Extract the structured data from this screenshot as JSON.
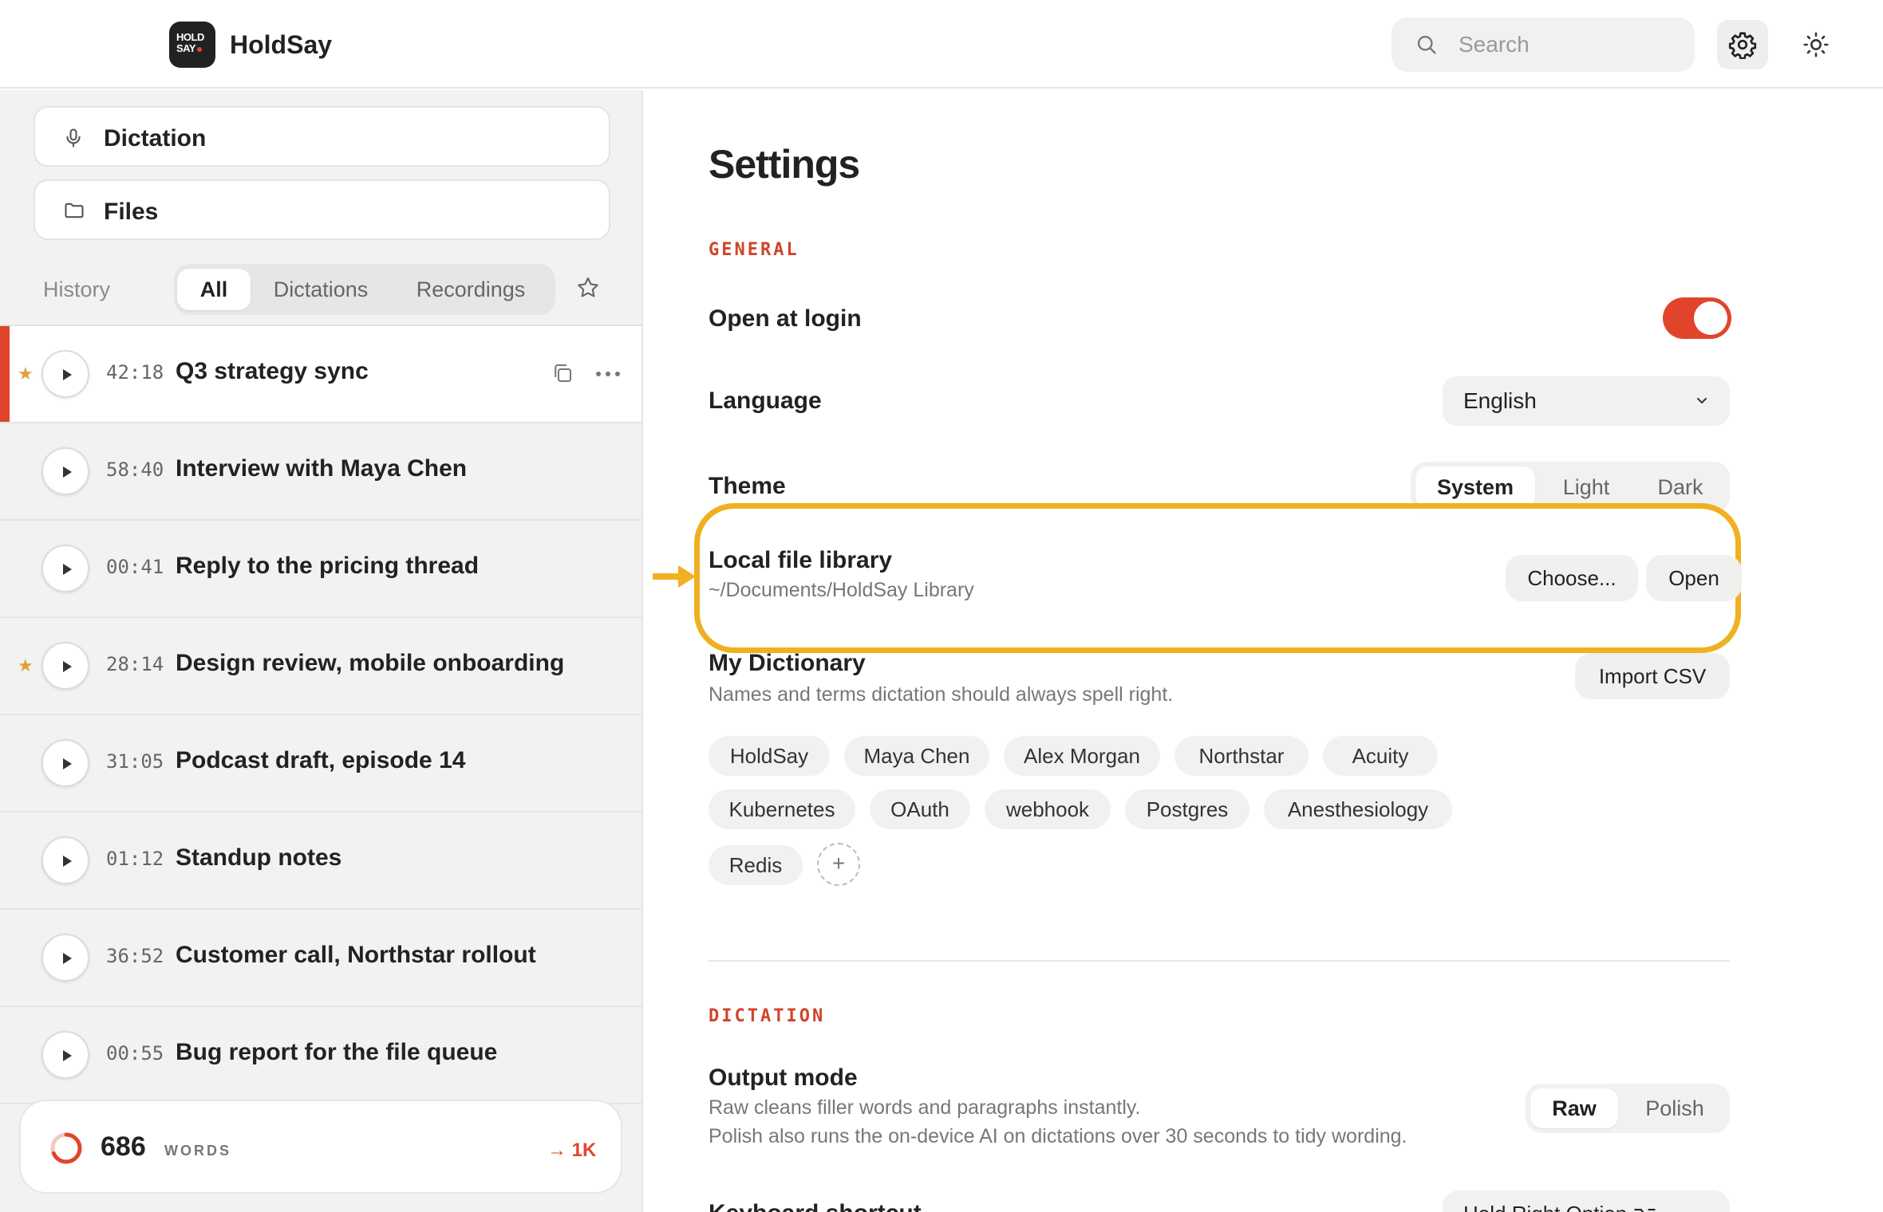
{
  "app": {
    "name": "HoldSay",
    "logo_text_1": "HOLD",
    "logo_text_2": "SAY"
  },
  "header": {
    "search_placeholder": "Search",
    "icons": [
      "search-icon",
      "gear-icon",
      "sun-icon"
    ]
  },
  "sidebar": {
    "nav": [
      {
        "label": "Dictation",
        "icon": "microphone-icon"
      },
      {
        "label": "Files",
        "icon": "folder-icon"
      }
    ],
    "history_label": "History",
    "filters": [
      "All",
      "Dictations",
      "Recordings"
    ],
    "active_filter": "All",
    "rows": [
      {
        "starred": true,
        "duration": "42:18",
        "title": "Q3 strategy sync",
        "selected": true
      },
      {
        "starred": false,
        "duration": "58:40",
        "title": "Interview with Maya Chen",
        "selected": false
      },
      {
        "starred": false,
        "duration": "00:41",
        "title": "Reply to the pricing thread",
        "selected": false
      },
      {
        "starred": true,
        "duration": "28:14",
        "title": "Design review, mobile onboarding",
        "selected": false
      },
      {
        "starred": false,
        "duration": "31:05",
        "title": "Podcast draft, episode 14",
        "selected": false
      },
      {
        "starred": false,
        "duration": "01:12",
        "title": "Standup notes",
        "selected": false
      },
      {
        "starred": false,
        "duration": "36:52",
        "title": "Customer call, Northstar rollout",
        "selected": false
      },
      {
        "starred": false,
        "duration": "00:55",
        "title": "Bug report for the file queue",
        "selected": false
      }
    ],
    "words": {
      "count": "686",
      "unit": "WORDS",
      "goal": "→ 1K",
      "progress": 0.686
    }
  },
  "settings": {
    "title": "Settings",
    "general_label": "GENERAL",
    "open_at_login": {
      "label": "Open at login",
      "enabled": true
    },
    "language": {
      "label": "Language",
      "value": "English"
    },
    "theme": {
      "label": "Theme",
      "options": [
        "System",
        "Light",
        "Dark"
      ],
      "selected": "System"
    },
    "library": {
      "label": "Local file library",
      "path": "~/Documents/HoldSay Library",
      "choose": "Choose...",
      "open": "Open"
    },
    "dictionary": {
      "label": "My Dictionary",
      "desc": "Names and terms dictation should always spell right.",
      "import": "Import CSV",
      "terms": [
        "HoldSay",
        "Maya Chen",
        "Alex Morgan",
        "Northstar",
        "Acuity",
        "Kubernetes",
        "OAuth",
        "webhook",
        "Postgres",
        "Anesthesiology",
        "Redis"
      ],
      "add": "+"
    },
    "dictation_label": "DICTATION",
    "output_mode": {
      "label": "Output mode",
      "desc1": "Raw cleans filler words and paragraphs instantly.",
      "desc2": "Polish also runs the on-device AI on dictations over 30 seconds to tidy wording.",
      "options": [
        "Raw",
        "Polish"
      ],
      "selected": "Raw"
    },
    "keyboard": {
      "label": "Keyboard shortcut",
      "value": "Hold Right Option ⌥"
    }
  },
  "colors": {
    "accent": "#e0452b",
    "highlight": "#f0b01f",
    "star": "#e0a13b"
  }
}
